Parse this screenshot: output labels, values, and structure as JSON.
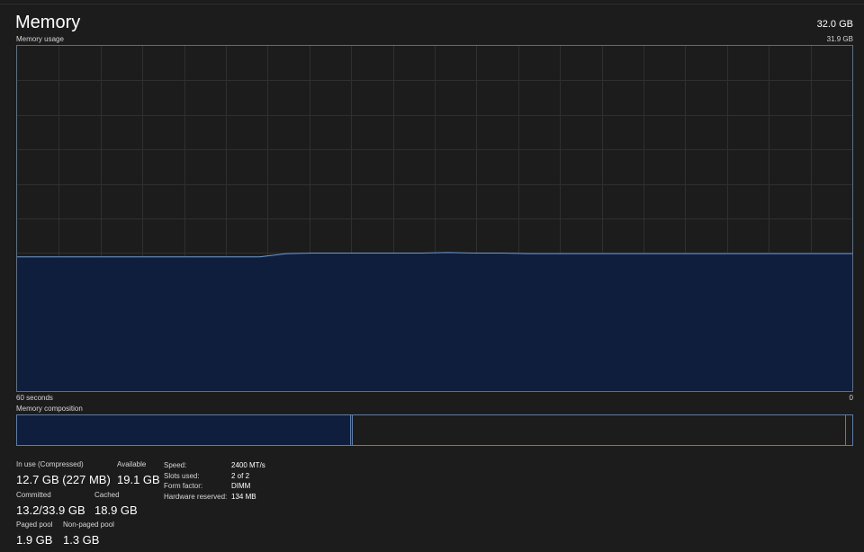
{
  "header": {
    "title": "Memory",
    "total": "32.0 GB"
  },
  "usage_graph": {
    "label": "Memory usage",
    "max_label": "31.9 GB",
    "time_left": "60 seconds",
    "time_right": "0",
    "fill_color": "#0f1e3d",
    "line_color": "#6e9bd6",
    "grid_color": "#2f2f2f",
    "max_gb": 31.9,
    "usage_history_gb": [
      12.4,
      12.4,
      12.4,
      12.4,
      12.4,
      12.4,
      12.4,
      12.4,
      12.4,
      12.4,
      12.7,
      12.75,
      12.75,
      12.75,
      12.75,
      12.75,
      12.8,
      12.75,
      12.75,
      12.7,
      12.7,
      12.7,
      12.7,
      12.7,
      12.7,
      12.7,
      12.7,
      12.7,
      12.7,
      12.7,
      12.7,
      12.7
    ]
  },
  "composition": {
    "label": "Memory composition",
    "in_use_fraction": 0.4,
    "modified_fraction": 0.002,
    "standby_fraction": 0.59,
    "free_fraction": 0.008
  },
  "stats": {
    "in_use": {
      "label": "In use (Compressed)",
      "value": "12.7 GB (227 MB)"
    },
    "available": {
      "label": "Available",
      "value": "19.1 GB"
    },
    "committed": {
      "label": "Committed",
      "value": "13.2/33.9 GB"
    },
    "cached": {
      "label": "Cached",
      "value": "18.9 GB"
    },
    "paged_pool": {
      "label": "Paged pool",
      "value": "1.9 GB"
    },
    "non_paged_pool": {
      "label": "Non-paged pool",
      "value": "1.3 GB"
    }
  },
  "specs": {
    "speed": {
      "label": "Speed:",
      "value": "2400 MT/s"
    },
    "slots": {
      "label": "Slots used:",
      "value": "2 of 2"
    },
    "form_factor": {
      "label": "Form factor:",
      "value": "DIMM"
    },
    "hw_reserved": {
      "label": "Hardware reserved:",
      "value": "134 MB"
    }
  }
}
